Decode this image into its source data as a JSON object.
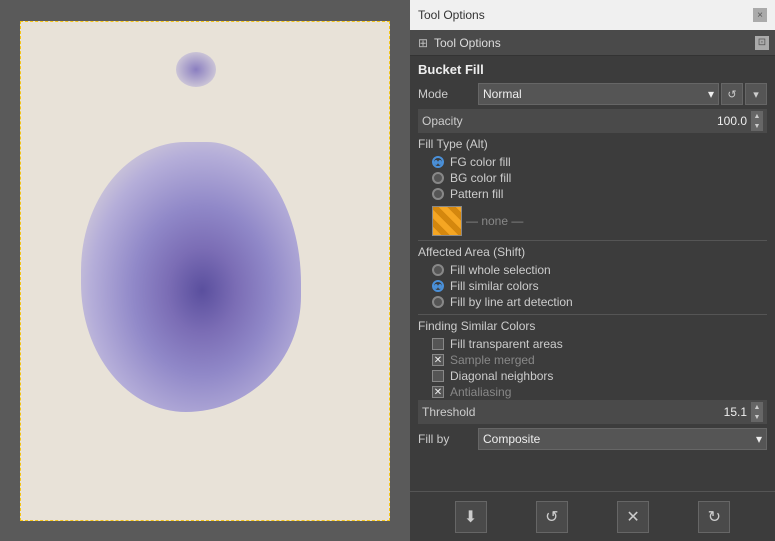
{
  "title_bar": {
    "text": "Tool Options",
    "close_btn": "×"
  },
  "sub_header": {
    "icon": "⊞",
    "label": "Tool Options",
    "dock_btn": "⊡"
  },
  "tool_options": {
    "section_title": "Bucket Fill",
    "mode": {
      "label": "Mode",
      "value": "Normal",
      "dropdown_arrow": "▾"
    },
    "mode_reset_btn": "↺",
    "mode_extra_btn": "▾",
    "opacity": {
      "label": "Opacity",
      "value": "100.0",
      "up": "▲",
      "down": "▼"
    },
    "fill_type": {
      "label": "Fill Type  (Alt)",
      "options": [
        {
          "id": "fg",
          "label": "FG color fill",
          "checked": true
        },
        {
          "id": "bg",
          "label": "BG color fill",
          "checked": false
        },
        {
          "id": "pattern",
          "label": "Pattern fill",
          "checked": false
        }
      ]
    },
    "pattern": {
      "name": "— none —"
    },
    "affected_area": {
      "label": "Affected Area  (Shift)",
      "options": [
        {
          "id": "whole",
          "label": "Fill whole selection",
          "checked": false
        },
        {
          "id": "similar",
          "label": "Fill similar colors",
          "checked": true
        },
        {
          "id": "line",
          "label": "Fill by line art detection",
          "checked": false
        }
      ]
    },
    "finding_similar_colors": {
      "label": "Finding Similar Colors",
      "options": [
        {
          "id": "transparent",
          "label": "Fill transparent areas",
          "checked": false,
          "type": "checkbox"
        },
        {
          "id": "sample_merged",
          "label": "Sample merged",
          "checked": true,
          "type": "checkbox"
        },
        {
          "id": "diagonal",
          "label": "Diagonal neighbors",
          "checked": false,
          "type": "checkbox"
        },
        {
          "id": "antialiasing",
          "label": "Antialiasing",
          "checked": true,
          "type": "checkbox"
        }
      ]
    },
    "threshold": {
      "label": "Threshold",
      "value": "15.1",
      "up": "▲",
      "down": "▼"
    },
    "fill_by": {
      "label": "Fill by",
      "value": "Composite",
      "dropdown_arrow": "▾"
    }
  },
  "bottom_toolbar": {
    "btn1": "⬇",
    "btn2": "↺",
    "btn3": "✕",
    "btn4": "↻"
  }
}
